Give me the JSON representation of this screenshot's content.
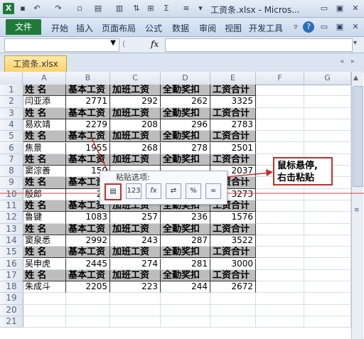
{
  "window": {
    "title": "工资条.xlsx - Micros..."
  },
  "ribbon": {
    "tabs": [
      "文件",
      "开始",
      "插入",
      "页面布局",
      "公式",
      "数据",
      "审阅",
      "视图",
      "开发工具"
    ]
  },
  "formula_bar": {
    "fx": "fx",
    "value": ""
  },
  "workbook_tab": {
    "label": "工资条.xlsx"
  },
  "columns": [
    "A",
    "B",
    "C",
    "D",
    "E",
    "F",
    "G"
  ],
  "header_row": [
    "姓  名",
    "基本工资",
    "加班工资",
    "全勤奖扣",
    "工资合计"
  ],
  "rows": [
    {
      "n": "1",
      "type": "h"
    },
    {
      "n": "2",
      "type": "d",
      "name": "闫亚添",
      "v": [
        "2771",
        "292",
        "262",
        "3325"
      ]
    },
    {
      "n": "3",
      "type": "h"
    },
    {
      "n": "4",
      "type": "d",
      "name": "易欢靖",
      "v": [
        "2279",
        "208",
        "296",
        "2783"
      ]
    },
    {
      "n": "5",
      "type": "h"
    },
    {
      "n": "6",
      "type": "d",
      "name": "焦景",
      "v": [
        "1955",
        "268",
        "278",
        "2501"
      ]
    },
    {
      "n": "7",
      "type": "h"
    },
    {
      "n": "8",
      "type": "d",
      "name": "窦淙善",
      "v": [
        "150",
        "",
        "",
        "2037"
      ]
    },
    {
      "n": "9",
      "type": "h"
    },
    {
      "n": "10",
      "type": "d",
      "name": "殷郎",
      "v": [
        "27",
        "",
        "",
        "3273"
      ]
    },
    {
      "n": "11",
      "type": "h"
    },
    {
      "n": "12",
      "type": "d",
      "name": "鲁键",
      "v": [
        "1083",
        "257",
        "236",
        "1576"
      ]
    },
    {
      "n": "13",
      "type": "h"
    },
    {
      "n": "14",
      "type": "d",
      "name": "窦泉悉",
      "v": [
        "2992",
        "243",
        "287",
        "3522"
      ]
    },
    {
      "n": "15",
      "type": "h"
    },
    {
      "n": "16",
      "type": "d",
      "name": "吴申虎",
      "v": [
        "2445",
        "274",
        "281",
        "3000"
      ]
    },
    {
      "n": "17",
      "type": "h"
    },
    {
      "n": "18",
      "type": "d",
      "name": "朱成斗",
      "v": [
        "2205",
        "223",
        "244",
        "2672"
      ]
    },
    {
      "n": "19",
      "type": "e"
    },
    {
      "n": "20",
      "type": "e"
    },
    {
      "n": "21",
      "type": "e"
    }
  ],
  "paste_popup": {
    "title": "粘贴选项:",
    "icon_labels": [
      "123",
      "fx",
      "%"
    ]
  },
  "callout": {
    "line1": "鼠标悬停,",
    "line2": "右击粘贴"
  },
  "colors": {
    "header_fill": "#bdbdbd",
    "excel_green": "#1f7a3a",
    "callout_red": "#c0302b"
  }
}
